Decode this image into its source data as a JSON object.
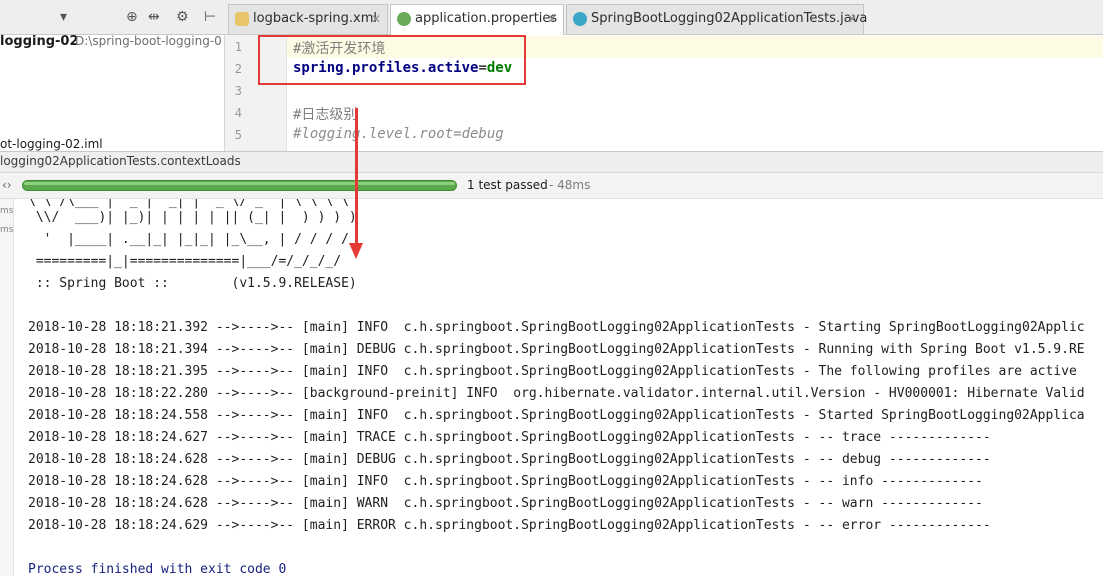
{
  "toolbar": {
    "icons": [
      "chevron-down-icon",
      "target-icon",
      "split-icon",
      "gear-icon",
      "hide-panel-icon"
    ]
  },
  "tabs": [
    {
      "label": "logback-spring.xml",
      "icon": "xml-file-icon",
      "active": false
    },
    {
      "label": "application.properties",
      "icon": "properties-file-icon",
      "active": true
    },
    {
      "label": "SpringBootLogging02ApplicationTests.java",
      "icon": "java-class-icon",
      "active": false
    }
  ],
  "project": {
    "name": "logging-02",
    "path": "D:\\spring-boot-logging-0",
    "iml_file": "ot-logging-02.iml"
  },
  "editor": {
    "lines": [
      {
        "num": "1",
        "comment": "#激活开发环境"
      },
      {
        "num": "2",
        "key": "spring.profiles.active",
        "eq": "=",
        "value": "dev"
      },
      {
        "num": "3"
      },
      {
        "num": "4",
        "comment": "#日志级别"
      },
      {
        "num": "5",
        "comment_italic": "#logging.level.root=debug"
      }
    ]
  },
  "run": {
    "title": "logging02ApplicationTests.contextLoads",
    "status": "1 test passed",
    "time": " - 48ms",
    "progress": 1.0,
    "side_labels": [
      "ms",
      "ms"
    ]
  },
  "console": {
    "banner": [
      "\\ \\ /\\___ | '_ | '_| | '_ \\/ _` | \\ \\ \\ \\",
      " \\\\/  ___)| |_)| | | | | || (_| |  ) ) ) )",
      "  '  |____| .__|_| |_|_| |_\\__, | / / / /",
      " =========|_|==============|___/=/_/_/_/",
      " :: Spring Boot ::        (v1.5.9.RELEASE)"
    ],
    "logs": [
      "2018-10-28 18:18:21.392 -->---->-- [main] INFO  c.h.springboot.SpringBootLogging02ApplicationTests - Starting SpringBootLogging02Applic",
      "2018-10-28 18:18:21.394 -->---->-- [main] DEBUG c.h.springboot.SpringBootLogging02ApplicationTests - Running with Spring Boot v1.5.9.RE",
      "2018-10-28 18:18:21.395 -->---->-- [main] INFO  c.h.springboot.SpringBootLogging02ApplicationTests - The following profiles are active",
      "2018-10-28 18:18:22.280 -->---->-- [background-preinit] INFO  org.hibernate.validator.internal.util.Version - HV000001: Hibernate Valid",
      "2018-10-28 18:18:24.558 -->---->-- [main] INFO  c.h.springboot.SpringBootLogging02ApplicationTests - Started SpringBootLogging02Applica",
      "2018-10-28 18:18:24.627 -->---->-- [main] TRACE c.h.springboot.SpringBootLogging02ApplicationTests - -- trace -------------",
      "2018-10-28 18:18:24.628 -->---->-- [main] DEBUG c.h.springboot.SpringBootLogging02ApplicationTests - -- debug -------------",
      "2018-10-28 18:18:24.628 -->---->-- [main] INFO  c.h.springboot.SpringBootLogging02ApplicationTests - -- info -------------",
      "2018-10-28 18:18:24.628 -->---->-- [main] WARN  c.h.springboot.SpringBootLogging02ApplicationTests - -- warn -------------",
      "2018-10-28 18:18:24.629 -->---->-- [main] ERROR c.h.springboot.SpringBootLogging02ApplicationTests - -- error -------------"
    ],
    "exit": "Process finished with exit code 0"
  },
  "colors": {
    "highlight_box": "#e53935",
    "arrow": "#e53935",
    "progress": "#59a84b"
  }
}
